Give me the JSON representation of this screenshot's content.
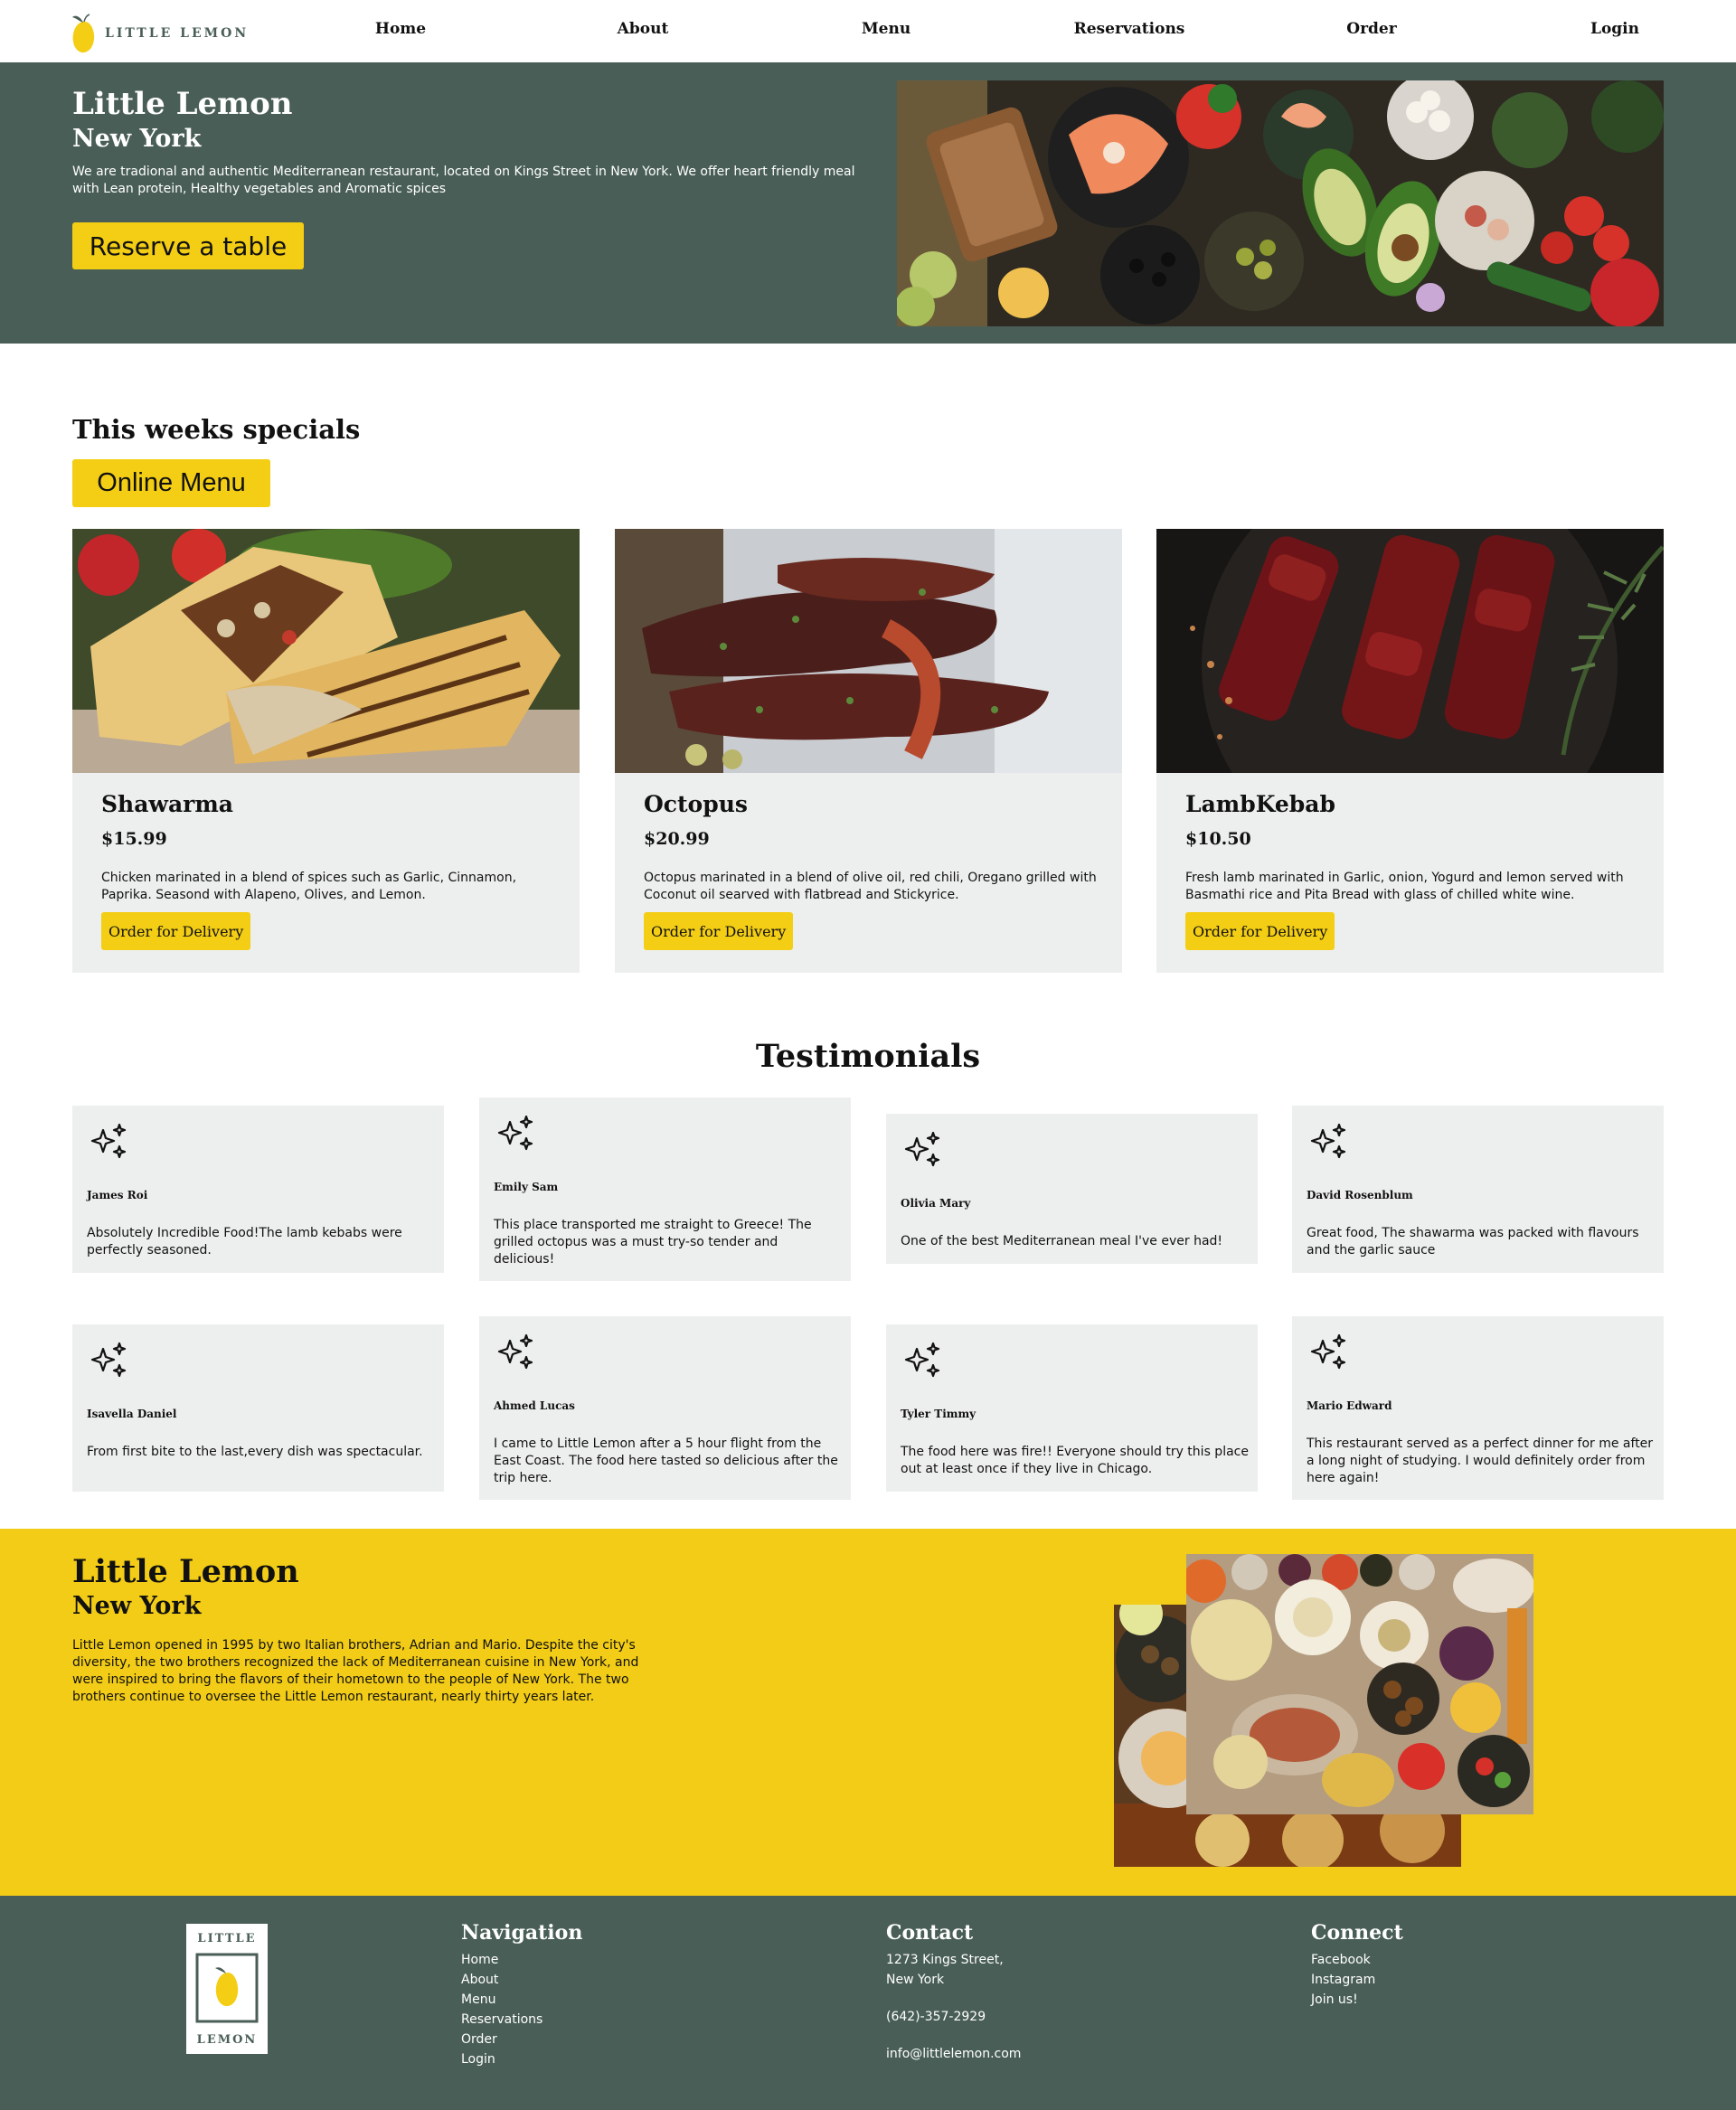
{
  "header": {
    "logo_text": "LITTLE LEMON",
    "nav": [
      "Home",
      "About",
      "Menu",
      "Reservations",
      "Order",
      "Login"
    ]
  },
  "hero": {
    "title": "Little Lemon",
    "subtitle": "New York",
    "description": "We are tradional and authentic Mediterranean restaurant, located on Kings Street in New York. We offer heart friendly meal with Lean protein, Healthy vegetables and Aromatic spices",
    "button": "Reserve a table"
  },
  "specials": {
    "title": "This weeks specials",
    "button": "Online Menu",
    "items": [
      {
        "name": "Shawarma",
        "price": "$15.99",
        "description": "Chicken marinated in a blend of spices such as Garlic, Cinnamon, Paprika. Seasond with Alapeno, Olives, and Lemon.",
        "button": "Order for Delivery"
      },
      {
        "name": "Octopus",
        "price": "$20.99",
        "description": "Octopus marinated in a blend of olive oil, red chili, Oregano grilled with Coconut oil searved with flatbread and Stickyrice.",
        "button": "Order for Delivery"
      },
      {
        "name": "LambKebab",
        "price": "$10.50",
        "description": "Fresh lamb marinated in Garlic, onion, Yogurd and lemon served with Basmathi rice and Pita Bread with glass of chilled white wine.",
        "button": "Order for Delivery"
      }
    ]
  },
  "testimonials": {
    "title": "Testimonials",
    "items": [
      {
        "name": "James Roi",
        "text": "Absolutely Incredible Food!The lamb kebabs were perfectly seasoned."
      },
      {
        "name": "Emily Sam",
        "text": "This place transported me straight to Greece! The grilled octopus was a must try-so tender and delicious!"
      },
      {
        "name": "Olivia Mary",
        "text": "One of the best Mediterranean meal I've ever had!"
      },
      {
        "name": "David Rosenblum",
        "text": "Great food, The shawarma was packed with flavours and the garlic sauce"
      },
      {
        "name": "Isavella Daniel",
        "text": "From first bite to the last,every dish was spectacular."
      },
      {
        "name": "Ahmed Lucas",
        "text": "I came to Little Lemon after a 5 hour flight from the East Coast. The food here tasted so delicious after the trip here."
      },
      {
        "name": "Tyler Timmy",
        "text": "The food here was fire!! Everyone should try this place out at least once if they live in Chicago."
      },
      {
        "name": "Mario Edward",
        "text": "This restaurant served as a perfect dinner for me after a long night of studying. I would definitely order from here again!"
      }
    ]
  },
  "about": {
    "title": "Little Lemon",
    "subtitle": "New York",
    "description": "Little Lemon opened in 1995 by two Italian brothers, Adrian and Mario. Despite the city's diversity, the two brothers recognized the lack of Mediterranean cuisine in New York, and were inspired to bring the flavors of their hometown to the people of New York. The two brothers continue to oversee the Little Lemon restaurant, nearly thirty years later."
  },
  "footer": {
    "logo_top": "LITTLE",
    "logo_bottom": "LEMON",
    "navigation": {
      "title": "Navigation",
      "links": [
        "Home",
        "About",
        "Menu",
        "Reservations",
        "Order",
        "Login"
      ]
    },
    "contact": {
      "title": "Contact",
      "address_line1": "1273 Kings Street,",
      "address_line2": "New York",
      "phone": "(642)-357-2929",
      "email": "info@littlelemon.com"
    },
    "connect": {
      "title": "Connect",
      "links": [
        "Facebook",
        "Instagram",
        "Join us!"
      ]
    }
  },
  "colors": {
    "primary_green": "#495e57",
    "primary_yellow": "#f4ce14",
    "card_gray": "#edefee"
  },
  "icons": {
    "testimonial": "sparkles-icon",
    "logo": "lemon-icon"
  }
}
